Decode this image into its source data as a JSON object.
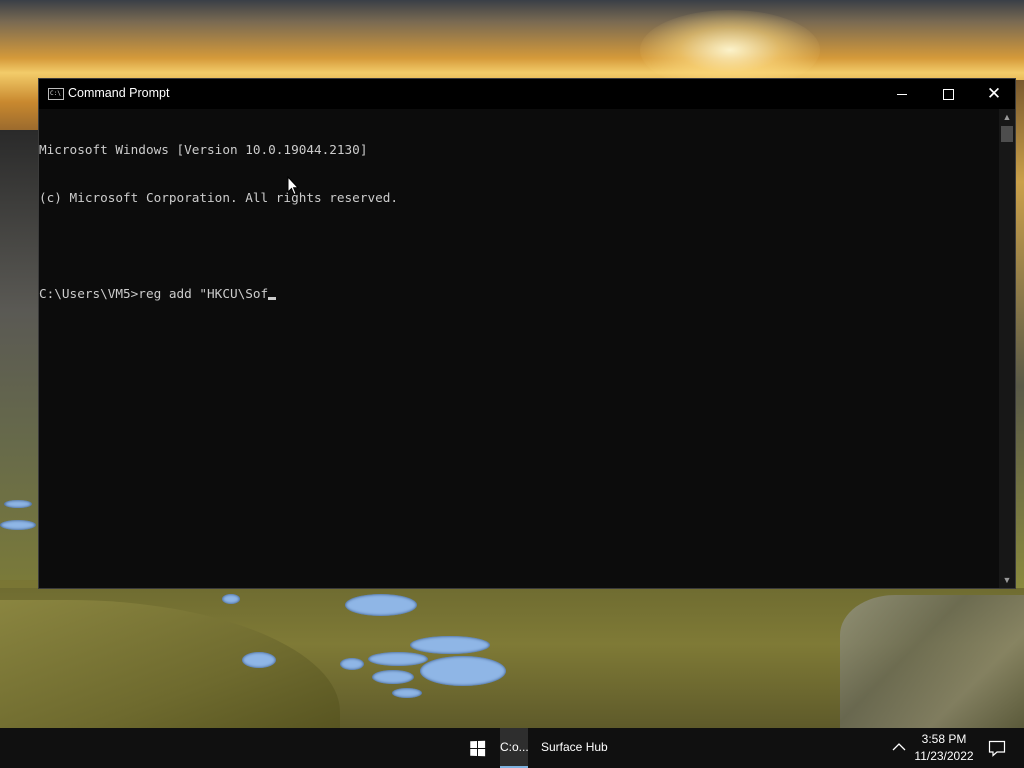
{
  "window": {
    "title": "Command Prompt",
    "icon_text": "C:\\",
    "controls": {
      "minimize": "minimize",
      "maximize": "maximize",
      "close": "✕"
    }
  },
  "console": {
    "lines": [
      "Microsoft Windows [Version 10.0.19044.2130]",
      "(c) Microsoft Corporation. All rights reserved.",
      "",
      "C:\\Users\\VM5>reg add \"HKCU\\Sof"
    ]
  },
  "scrollbar": {
    "up_arrow": "▲",
    "down_arrow": "▼"
  },
  "taskbar": {
    "start_icon": "windows-logo-icon",
    "items": [
      {
        "label": "C:o...",
        "active": true
      },
      {
        "label": "Surface Hub",
        "active": false
      }
    ],
    "clock": {
      "time": "3:58 PM",
      "date": "11/23/2022"
    }
  },
  "colors": {
    "console_bg": "#0c0c0c",
    "console_text": "#cccccc",
    "taskbar_bg": "#101010",
    "active_underline": "#7fb3e0"
  }
}
